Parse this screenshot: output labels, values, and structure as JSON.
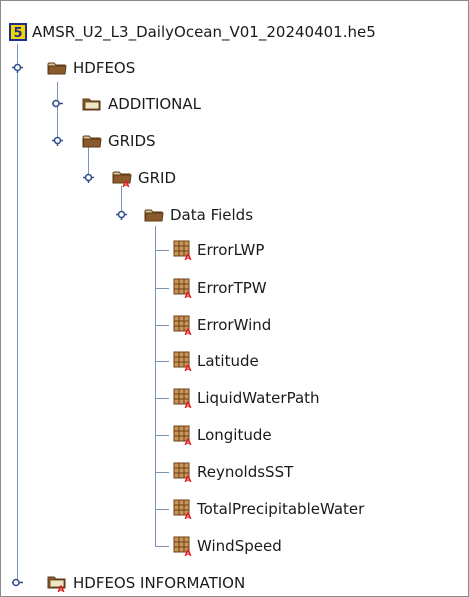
{
  "tree": {
    "root": {
      "label": "AMSR_U2_L3_DailyOcean_V01_20240401.he5",
      "icon": "hdf5-file-icon"
    },
    "hdfeos": {
      "label": "HDFEOS",
      "icon": "folder-open-icon"
    },
    "additional": {
      "label": "ADDITIONAL",
      "icon": "folder-closed-icon"
    },
    "grids": {
      "label": "GRIDS",
      "icon": "folder-open-icon"
    },
    "grid": {
      "label": "GRID",
      "icon": "folder-open-attribute-icon"
    },
    "data_fields": {
      "label": "Data Fields",
      "icon": "folder-open-icon"
    },
    "datasets": [
      {
        "label": "ErrorLWP",
        "icon": "dataset-attribute-icon"
      },
      {
        "label": "ErrorTPW",
        "icon": "dataset-attribute-icon"
      },
      {
        "label": "ErrorWind",
        "icon": "dataset-attribute-icon"
      },
      {
        "label": "Latitude",
        "icon": "dataset-attribute-icon"
      },
      {
        "label": "LiquidWaterPath",
        "icon": "dataset-attribute-icon"
      },
      {
        "label": "Longitude",
        "icon": "dataset-attribute-icon"
      },
      {
        "label": "ReynoldsSST",
        "icon": "dataset-attribute-icon"
      },
      {
        "label": "TotalPrecipitableWater",
        "icon": "dataset-attribute-icon"
      },
      {
        "label": "WindSpeed",
        "icon": "dataset-attribute-icon"
      }
    ],
    "hdfeos_information": {
      "label": "HDFEOS INFORMATION",
      "icon": "folder-closed-attribute-icon"
    }
  },
  "colors": {
    "folder": "#8b5a2b",
    "folder_light": "#d8c69a",
    "attribute_red": "#e02020",
    "file_icon_yellow": "#f2d600",
    "file_icon_blue": "#1f2f8f",
    "tree_line": "#7b93b6",
    "handle_blue": "#2d4f8c"
  }
}
